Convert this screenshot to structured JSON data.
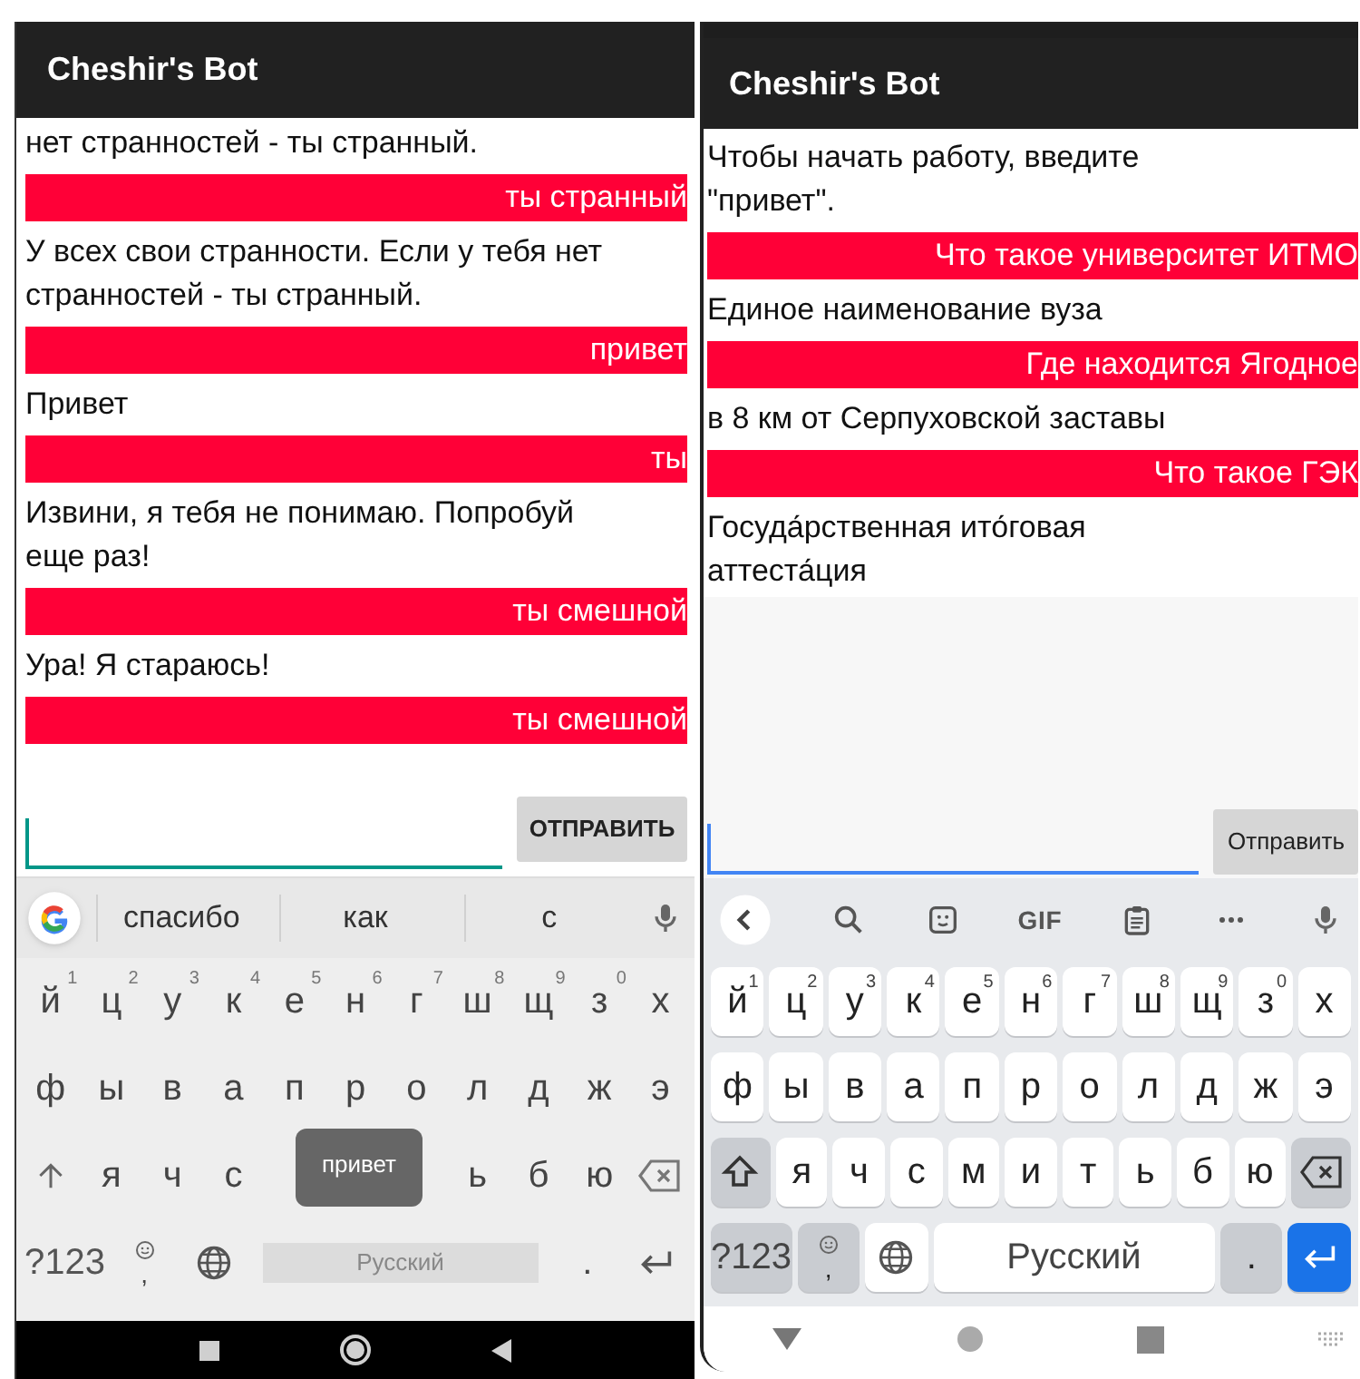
{
  "phones": [
    {
      "title": "Cheshir's Bot",
      "messages": [
        {
          "kind": "bot",
          "text": "нет странностей - ты странный."
        },
        {
          "kind": "user",
          "text": "ты странный"
        },
        {
          "kind": "bot",
          "text": "У всех свои странности. Если у тебя нет странностей - ты странный."
        },
        {
          "kind": "user",
          "text": "привет"
        },
        {
          "kind": "bot",
          "text": "Привет"
        },
        {
          "kind": "user",
          "text": "ты"
        },
        {
          "kind": "bot",
          "text": "Извини, я тебя не понимаю. Попробуй еще раз!"
        },
        {
          "kind": "user",
          "text": "ты смешной"
        },
        {
          "kind": "bot",
          "text": "Ура! Я стараюсь!"
        },
        {
          "kind": "user",
          "text": "ты смешной"
        }
      ],
      "send_button": "ОТПРАВИТЬ",
      "toolbar": [
        {
          "kind": "logo"
        },
        {
          "kind": "suggestion",
          "text": "спасибо"
        },
        {
          "kind": "suggestion",
          "text": "как"
        },
        {
          "kind": "suggestion",
          "text": "с"
        },
        {
          "kind": "mic"
        }
      ],
      "key_rows": [
        {
          "keys": [
            {
              "kind": "letter",
              "label": "й",
              "hint": "1"
            },
            {
              "kind": "letter",
              "label": "ц",
              "hint": "2"
            },
            {
              "kind": "letter",
              "label": "у",
              "hint": "3"
            },
            {
              "kind": "letter",
              "label": "к",
              "hint": "4"
            },
            {
              "kind": "letter",
              "label": "е",
              "hint": "5"
            },
            {
              "kind": "letter",
              "label": "н",
              "hint": "6"
            },
            {
              "kind": "letter",
              "label": "г",
              "hint": "7"
            },
            {
              "kind": "letter",
              "label": "ш",
              "hint": "8"
            },
            {
              "kind": "letter",
              "label": "щ",
              "hint": "9"
            },
            {
              "kind": "letter",
              "label": "з",
              "hint": "0"
            },
            {
              "kind": "letter",
              "label": "х"
            }
          ]
        },
        {
          "keys": [
            {
              "kind": "letter",
              "label": "ф"
            },
            {
              "kind": "letter",
              "label": "ы"
            },
            {
              "kind": "letter",
              "label": "в"
            },
            {
              "kind": "letter",
              "label": "а"
            },
            {
              "kind": "letter",
              "label": "п"
            },
            {
              "kind": "letter",
              "label": "р"
            },
            {
              "kind": "letter",
              "label": "о"
            },
            {
              "kind": "letter",
              "label": "л"
            },
            {
              "kind": "letter",
              "label": "д"
            },
            {
              "kind": "letter",
              "label": "ж"
            },
            {
              "kind": "letter",
              "label": "э"
            }
          ]
        },
        {
          "keys": [
            {
              "kind": "shift"
            },
            {
              "kind": "letter",
              "label": "я"
            },
            {
              "kind": "letter",
              "label": "ч"
            },
            {
              "kind": "letter",
              "label": "с"
            },
            {
              "kind": "covered"
            },
            {
              "kind": "covered"
            },
            {
              "kind": "covered"
            },
            {
              "kind": "letter",
              "label": "ь"
            },
            {
              "kind": "letter",
              "label": "б"
            },
            {
              "kind": "letter",
              "label": "ю"
            },
            {
              "kind": "backspace"
            }
          ]
        },
        {
          "keys": [
            {
              "kind": "symbols",
              "label": "?123"
            },
            {
              "kind": "emoji_comma",
              "label": ","
            },
            {
              "kind": "globe"
            },
            {
              "kind": "space",
              "label": "Русский"
            },
            {
              "kind": "period",
              "label": "."
            },
            {
              "kind": "enter"
            }
          ]
        }
      ],
      "key_popup": "привет"
    },
    {
      "title": "Cheshir's Bot",
      "messages": [
        {
          "kind": "bot",
          "text": "Чтобы начать работу, введите \"привет\"."
        },
        {
          "kind": "user",
          "text": "Что такое университет ИТМО"
        },
        {
          "kind": "bot",
          "text": "Единое наименование вуза"
        },
        {
          "kind": "user",
          "text": "Где находится Ягодное"
        },
        {
          "kind": "bot",
          "text": "в 8 км от Серпуховской заставы"
        },
        {
          "kind": "user",
          "text": "Что такое ГЭК"
        },
        {
          "kind": "bot",
          "text": "Госуда́рственная ито́говая аттеста́ция"
        }
      ],
      "send_button": "Отправить",
      "toolbar": [
        {
          "kind": "back"
        },
        {
          "kind": "search"
        },
        {
          "kind": "sticker"
        },
        {
          "kind": "gif",
          "text": "GIF"
        },
        {
          "kind": "clipboard"
        },
        {
          "kind": "more"
        },
        {
          "kind": "mic"
        }
      ],
      "key_rows": [
        {
          "keys": [
            {
              "kind": "letter",
              "label": "й",
              "hint": "1"
            },
            {
              "kind": "letter",
              "label": "ц",
              "hint": "2"
            },
            {
              "kind": "letter",
              "label": "у",
              "hint": "3"
            },
            {
              "kind": "letter",
              "label": "к",
              "hint": "4"
            },
            {
              "kind": "letter",
              "label": "е",
              "hint": "5"
            },
            {
              "kind": "letter",
              "label": "н",
              "hint": "6"
            },
            {
              "kind": "letter",
              "label": "г",
              "hint": "7"
            },
            {
              "kind": "letter",
              "label": "ш",
              "hint": "8"
            },
            {
              "kind": "letter",
              "label": "щ",
              "hint": "9"
            },
            {
              "kind": "letter",
              "label": "з",
              "hint": "0"
            },
            {
              "kind": "letter",
              "label": "х"
            }
          ]
        },
        {
          "keys": [
            {
              "kind": "letter",
              "label": "ф"
            },
            {
              "kind": "letter",
              "label": "ы"
            },
            {
              "kind": "letter",
              "label": "в"
            },
            {
              "kind": "letter",
              "label": "а"
            },
            {
              "kind": "letter",
              "label": "п"
            },
            {
              "kind": "letter",
              "label": "р"
            },
            {
              "kind": "letter",
              "label": "о"
            },
            {
              "kind": "letter",
              "label": "л"
            },
            {
              "kind": "letter",
              "label": "д"
            },
            {
              "kind": "letter",
              "label": "ж"
            },
            {
              "kind": "letter",
              "label": "э"
            }
          ]
        },
        {
          "keys": [
            {
              "kind": "shift"
            },
            {
              "kind": "letter",
              "label": "я"
            },
            {
              "kind": "letter",
              "label": "ч"
            },
            {
              "kind": "letter",
              "label": "с"
            },
            {
              "kind": "letter",
              "label": "м"
            },
            {
              "kind": "letter",
              "label": "и"
            },
            {
              "kind": "letter",
              "label": "т"
            },
            {
              "kind": "letter",
              "label": "ь"
            },
            {
              "kind": "letter",
              "label": "б"
            },
            {
              "kind": "letter",
              "label": "ю"
            },
            {
              "kind": "backspace"
            }
          ]
        },
        {
          "keys": [
            {
              "kind": "symbols",
              "label": "?123"
            },
            {
              "kind": "emoji_comma",
              "label": ","
            },
            {
              "kind": "globe"
            },
            {
              "kind": "space",
              "label": "Русский"
            },
            {
              "kind": "period",
              "label": "."
            },
            {
              "kind": "enter"
            }
          ]
        }
      ]
    }
  ]
}
